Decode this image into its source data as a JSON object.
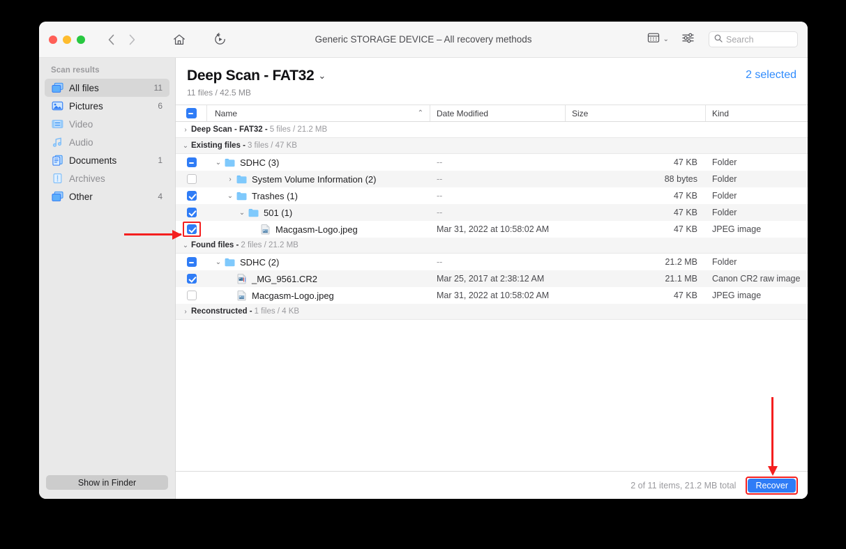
{
  "window": {
    "title": "Generic STORAGE DEVICE – All recovery methods",
    "traffic": {
      "close": "close-button",
      "minimize": "minimize-button",
      "zoom": "zoom-button"
    }
  },
  "toolbar": {
    "back_icon": "chevron-left-icon",
    "forward_icon": "chevron-right-icon",
    "home_icon": "home-icon",
    "rescan_icon": "replay-icon",
    "view_icon": "grid-view-icon",
    "view_chevron": "⌄",
    "settings_icon": "sliders-icon",
    "search": {
      "placeholder": "Search",
      "value": "",
      "icon": "search-icon"
    }
  },
  "sidebar": {
    "header": "Scan results",
    "items": [
      {
        "label": "All files",
        "count": "11",
        "icon": "all-files-icon",
        "active": true,
        "muted": false
      },
      {
        "label": "Pictures",
        "count": "6",
        "icon": "pictures-icon",
        "active": false,
        "muted": false
      },
      {
        "label": "Video",
        "count": "",
        "icon": "video-icon",
        "active": false,
        "muted": true
      },
      {
        "label": "Audio",
        "count": "",
        "icon": "audio-icon",
        "active": false,
        "muted": true
      },
      {
        "label": "Documents",
        "count": "1",
        "icon": "documents-icon",
        "active": false,
        "muted": false
      },
      {
        "label": "Archives",
        "count": "",
        "icon": "archives-icon",
        "active": false,
        "muted": true
      },
      {
        "label": "Other",
        "count": "4",
        "icon": "other-icon",
        "active": false,
        "muted": false
      }
    ],
    "show_in_finder": "Show in Finder"
  },
  "main": {
    "title": "Deep Scan - FAT32",
    "title_chevron": "⌄",
    "subtitle": "11 files / 42.5 MB",
    "selected_label": "2 selected",
    "columns": {
      "name": "Name",
      "date_modified": "Date Modified",
      "size": "Size",
      "kind": "Kind",
      "sort_caret": "⌃",
      "header_checkbox_state": "mixed"
    },
    "rows": [
      {
        "type": "group",
        "expanded": false,
        "name": "Deep Scan - FAT32 -",
        "meta": "5 files / 21.2 MB"
      },
      {
        "type": "group",
        "expanded": true,
        "name": "Existing files -",
        "meta": "3 files / 47 KB"
      },
      {
        "type": "file",
        "indent": 0,
        "check": "mixed",
        "disc": "down",
        "icon": "folder-icon",
        "name": "SDHC (3)",
        "date": "--",
        "size": "47 KB",
        "kind": "Folder"
      },
      {
        "type": "file",
        "indent": 1,
        "check": "off",
        "disc": "right",
        "icon": "folder-icon",
        "name": "System Volume Information (2)",
        "date": "--",
        "size": "88 bytes",
        "kind": "Folder"
      },
      {
        "type": "file",
        "indent": 1,
        "check": "on",
        "disc": "down",
        "icon": "folder-icon",
        "name": "Trashes (1)",
        "date": "--",
        "size": "47 KB",
        "kind": "Folder"
      },
      {
        "type": "file",
        "indent": 2,
        "check": "on",
        "disc": "down",
        "icon": "folder-icon",
        "name": "501 (1)",
        "date": "--",
        "size": "47 KB",
        "kind": "Folder"
      },
      {
        "type": "file",
        "indent": 3,
        "check": "on",
        "disc": "none",
        "icon": "jpeg-file-icon",
        "name": "Macgasm-Logo.jpeg",
        "date": "Mar 31, 2022 at 10:58:02 AM",
        "size": "47 KB",
        "kind": "JPEG image"
      },
      {
        "type": "group",
        "expanded": true,
        "name": "Found files -",
        "meta": "2 files / 21.2 MB"
      },
      {
        "type": "file",
        "indent": 0,
        "check": "mixed",
        "disc": "down",
        "icon": "folder-icon",
        "name": "SDHC (2)",
        "date": "--",
        "size": "21.2 MB",
        "kind": "Folder"
      },
      {
        "type": "file",
        "indent": 1,
        "check": "on",
        "disc": "none",
        "icon": "cr2-file-icon",
        "name": "_MG_9561.CR2",
        "date": "Mar 25, 2017 at 2:38:12 AM",
        "size": "21.1 MB",
        "kind": "Canon CR2 raw image"
      },
      {
        "type": "file",
        "indent": 1,
        "check": "off",
        "disc": "none",
        "icon": "jpeg-file-icon",
        "name": "Macgasm-Logo.jpeg",
        "date": "Mar 31, 2022 at 10:58:02 AM",
        "size": "47 KB",
        "kind": "JPEG image"
      },
      {
        "type": "group",
        "expanded": false,
        "name": "Reconstructed -",
        "meta": "1 files / 4 KB"
      }
    ]
  },
  "footer": {
    "status": "2 of 11 items, 21.2 MB total",
    "recover_label": "Recover"
  },
  "annotations": {
    "highlight_checkbox": "selected-file-checkbox-highlight",
    "highlight_recover": "recover-button-highlight",
    "arrow_left": "arrow-pointing-to-checkbox",
    "arrow_down": "arrow-pointing-to-recover"
  },
  "colors": {
    "accent": "#2f7cf6",
    "annotation": "#f41f1f",
    "sidebar_bg": "#e9e9e9",
    "link": "#2f8bfd"
  }
}
